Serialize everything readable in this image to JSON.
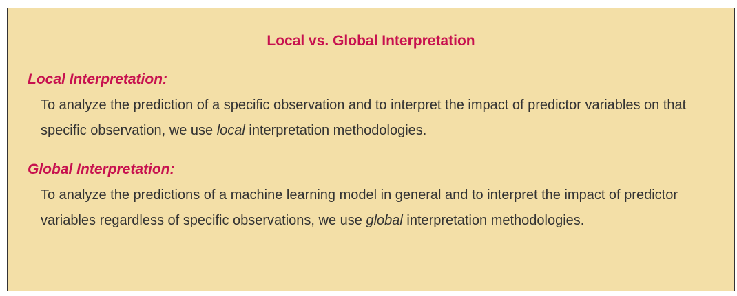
{
  "box": {
    "title": "Local vs. Global Interpretation",
    "sections": [
      {
        "heading": "Local Interpretation:",
        "text_before": "To analyze the prediction of a specific observation and to interpret the impact of predictor variables on that specific observation, we use ",
        "emphasis": "local",
        "text_after": " interpretation methodologies."
      },
      {
        "heading": "Global Interpretation:",
        "text_before": "To analyze the predictions of a machine learning model in general and to interpret the impact of predictor variables regardless of specific observations, we use ",
        "emphasis": "global",
        "text_after": " interpretation methodologies."
      }
    ],
    "colors": {
      "background": "#f3dfa7",
      "accent": "#c7114f",
      "text": "#333333",
      "border": "#333333"
    }
  }
}
